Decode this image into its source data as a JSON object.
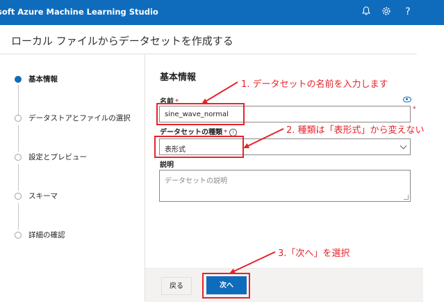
{
  "app": {
    "title": "soft Azure Machine Learning Studio",
    "icons": [
      "bell-icon",
      "gear-icon",
      "help-icon"
    ],
    "brand_color": "#0f6cbd"
  },
  "page": {
    "title": "ローカル ファイルからデータセットを作成する"
  },
  "steps": [
    {
      "label": "基本情報",
      "active": true
    },
    {
      "label": "データストアとファイルの選択",
      "active": false
    },
    {
      "label": "設定とプレビュー",
      "active": false
    },
    {
      "label": "スキーマ",
      "active": false
    },
    {
      "label": "詳細の確認",
      "active": false
    }
  ],
  "form": {
    "section_title": "基本情報",
    "name": {
      "label": "名前",
      "required": "*",
      "value": "sine_wave_normal"
    },
    "dataset_type": {
      "label": "データセットの種類",
      "required": "*",
      "info": "i",
      "value": "表形式"
    },
    "description": {
      "label": "説明",
      "placeholder": "データセットの説明"
    }
  },
  "footer": {
    "back_label": "戻る",
    "next_label": "次へ"
  },
  "annotations": {
    "note1": "1. データセットの名前を入力します",
    "note2": "2. 種類は「表形式」から変えない",
    "note3": "3.「次へ」を選択",
    "color": "#e5232a"
  }
}
